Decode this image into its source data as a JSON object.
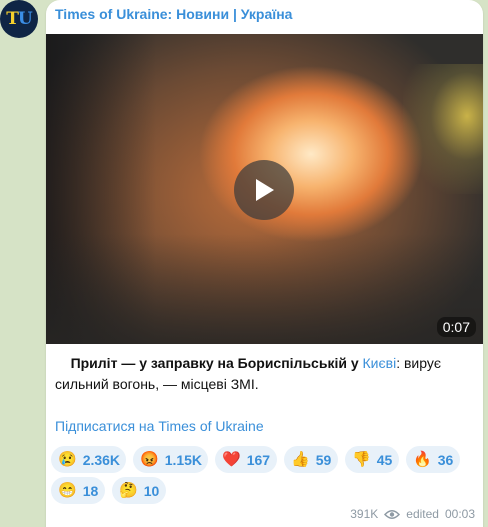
{
  "channel": {
    "avatar_letters": [
      "T",
      "U"
    ],
    "name": "Times of Ukraine: Новини | Україна"
  },
  "video": {
    "duration": "0:07"
  },
  "message": {
    "text_bold": "Приліт — у заправку на Бориспільській у ",
    "link_text": "Києві",
    "text_rest": ": вирує сильний вогонь, — місцеві ЗМІ.",
    "subscribe_link": "Підписатися на Times of Ukraine"
  },
  "reactions": [
    {
      "emoji": "😢",
      "icon": "crying-face-icon",
      "count": "2.36K"
    },
    {
      "emoji": "😡",
      "icon": "angry-face-icon",
      "count": "1.15K"
    },
    {
      "emoji": "❤️",
      "icon": "red-heart-icon",
      "count": "167"
    },
    {
      "emoji": "👍",
      "icon": "thumbs-up-icon",
      "count": "59"
    },
    {
      "emoji": "👎",
      "icon": "thumbs-down-icon",
      "count": "45"
    },
    {
      "emoji": "🔥",
      "icon": "fire-icon",
      "count": "36"
    },
    {
      "emoji": "😁",
      "icon": "grinning-face-icon",
      "count": "18"
    },
    {
      "emoji": "🤔",
      "icon": "thinking-face-icon",
      "count": "10"
    }
  ],
  "meta": {
    "views": "391K",
    "views_icon": "eye-icon",
    "edited_label": "edited",
    "time": "00:03"
  },
  "colors": {
    "accent": "#3a8fd9",
    "background": "#d6e3c6",
    "bubble": "#ffffff",
    "reaction_bg": "#e8f1f9",
    "avatar_bg": "#0f2545"
  }
}
